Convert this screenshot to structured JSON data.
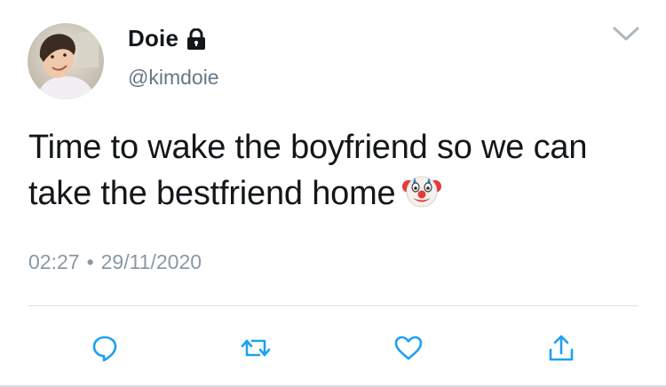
{
  "author": {
    "display_name": "Doie",
    "handle": "@kimdoie",
    "avatar_icon": "avatar-photo",
    "protected_icon": "lock-icon"
  },
  "tweet": {
    "text": "Time to wake the boyfriend so we can take the bestfriend home",
    "emoji_icon": "clown-face-icon"
  },
  "meta": {
    "time": "02:27",
    "separator": "•",
    "date": "29/11/2020"
  },
  "menu_icon": "chevron-down-icon",
  "actions": [
    {
      "name": "reply",
      "icon": "reply-icon"
    },
    {
      "name": "retweet",
      "icon": "retweet-icon"
    },
    {
      "name": "like",
      "icon": "heart-icon"
    },
    {
      "name": "share",
      "icon": "share-icon"
    }
  ],
  "colors": {
    "text": "#14171a",
    "secondary": "#657786",
    "meta": "#8899a6",
    "action_icon": "#1da1f2"
  }
}
